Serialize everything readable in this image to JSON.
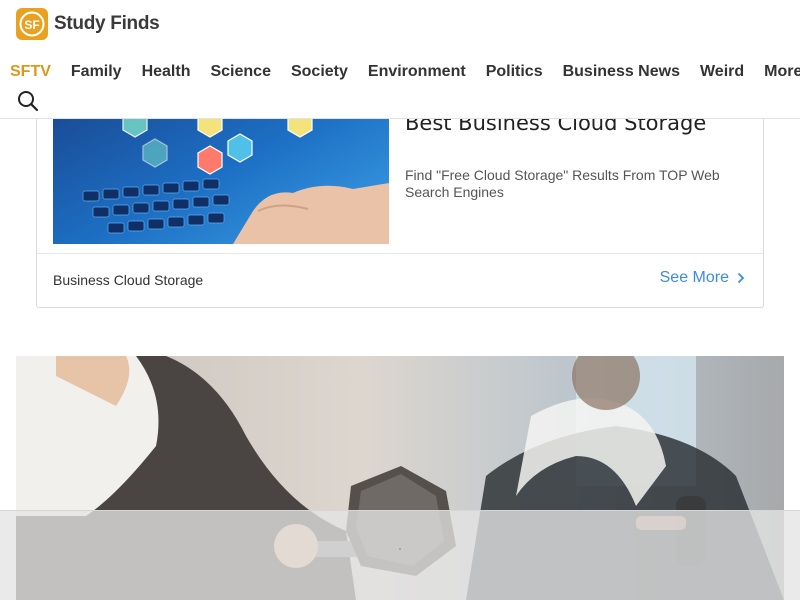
{
  "brand": {
    "logo_initials": "SF",
    "name": "Study Finds",
    "accent_color": "#d99a1c"
  },
  "nav": {
    "items": [
      {
        "label": "SFTV",
        "active": true
      },
      {
        "label": "Family"
      },
      {
        "label": "Health"
      },
      {
        "label": "Science"
      },
      {
        "label": "Society"
      },
      {
        "label": "Environment"
      },
      {
        "label": "Politics"
      },
      {
        "label": "Business News"
      },
      {
        "label": "Weird"
      },
      {
        "label": "More..."
      }
    ],
    "search_icon": "search-icon"
  },
  "ad": {
    "title": "Best Business Cloud Storage",
    "description": "Find \"Free Cloud Storage\" Results From TOP Web Search Engines",
    "footer_label": "Business Cloud Storage",
    "cta_label": "See More",
    "cta_color": "#3b8be0",
    "cta_icon": "chevron-right-icon"
  },
  "hero": {
    "subject": "gym-dumbbell-photo"
  }
}
